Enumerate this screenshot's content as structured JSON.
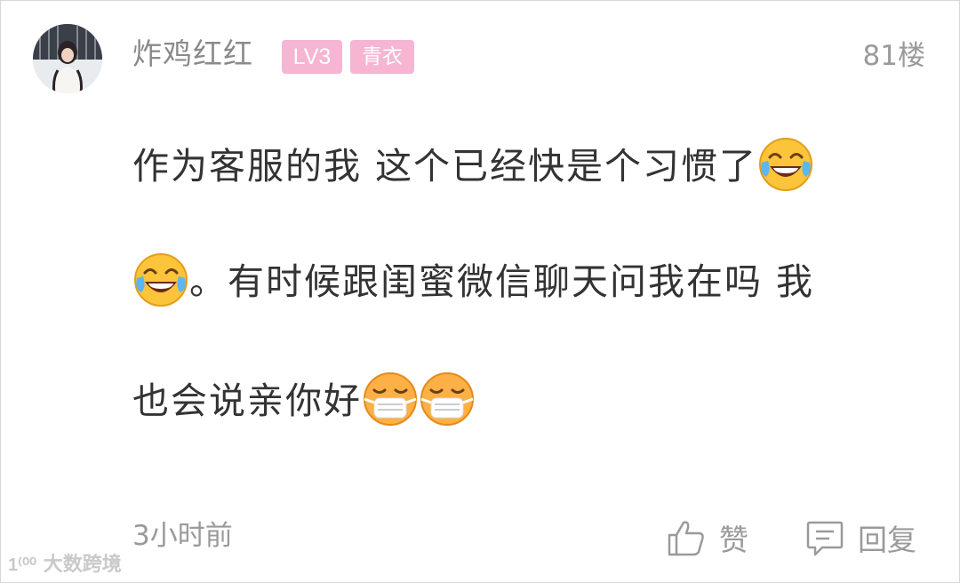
{
  "post": {
    "username": "炸鸡红红",
    "level_badge": "LV3",
    "rank_badge": "青衣",
    "floor": "81楼",
    "content": {
      "line1_text": "作为客服的我 这个已经快是个习惯了",
      "line2_text": "。有时候跟闺蜜微信聊天问我在吗 我",
      "line3_text": "也会说亲你好"
    },
    "time": "3小时前",
    "like_label": "赞",
    "reply_label": "回复"
  },
  "icons": {
    "laugh_cry": "laughing-crying-emoji",
    "mask": "face-with-mask-emoji",
    "like": "thumbs-up-icon",
    "reply": "comment-icon"
  },
  "colors": {
    "badge_bg": "#f5b5d3",
    "text_main": "#333333",
    "text_muted": "#9a9a9a"
  },
  "watermark": "大数跨境"
}
